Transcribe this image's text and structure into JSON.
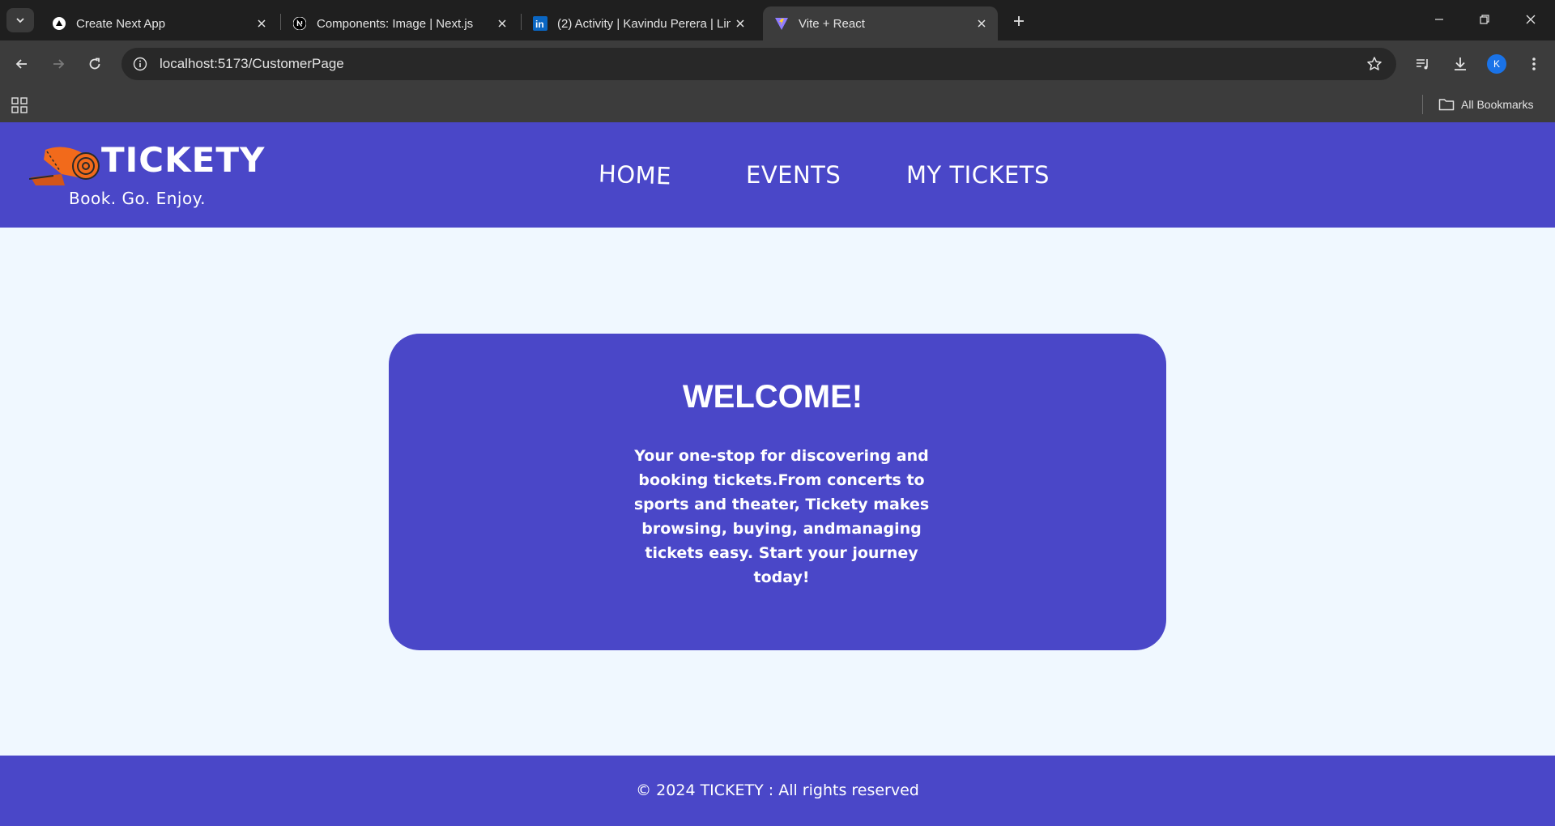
{
  "browser": {
    "tabs": [
      {
        "title": "Create Next App",
        "icon": "vercel-triangle-icon",
        "active": false
      },
      {
        "title": "Components: Image | Next.js",
        "icon": "nextjs-icon",
        "active": false
      },
      {
        "title": "(2) Activity | Kavindu Perera | Lin",
        "icon": "linkedin-icon",
        "active": false
      },
      {
        "title": "Vite + React",
        "icon": "vite-icon",
        "active": true
      }
    ],
    "url": "localhost:5173/CustomerPage",
    "profile_initial": "K",
    "bookmarks_label": "All Bookmarks"
  },
  "site": {
    "logo_text": "TICKETY",
    "tagline": "Book. Go. Enjoy.",
    "nav": [
      "HOME",
      "EVENTS",
      "MY TICKETS"
    ]
  },
  "welcome": {
    "heading": "WELCOME!",
    "body": "Your one-stop for discovering and booking tickets.From concerts to sports and theater, Tickety makes browsing, buying, andmanaging tickets easy. Start your journey today!"
  },
  "footer": {
    "copyright": "© 2024 TICKETY : All rights reserved"
  },
  "colors": {
    "brand": "#4a47c8",
    "page_bg": "#f0f8ff",
    "logo_orange": "#f26a1b"
  }
}
